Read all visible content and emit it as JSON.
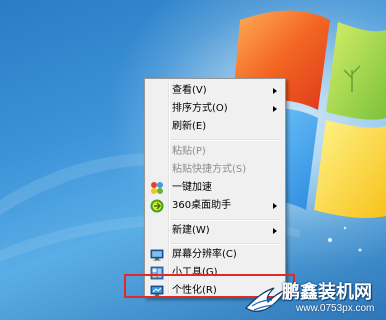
{
  "menu": {
    "items": [
      {
        "label": "查看(V)",
        "submenu": true,
        "disabled": false,
        "icon": null
      },
      {
        "label": "排序方式(O)",
        "submenu": true,
        "disabled": false,
        "icon": null
      },
      {
        "label": "刷新(E)",
        "submenu": false,
        "disabled": false,
        "icon": null
      },
      {
        "label": "粘贴(P)",
        "submenu": false,
        "disabled": true,
        "icon": null
      },
      {
        "label": "粘贴快捷方式(S)",
        "submenu": false,
        "disabled": true,
        "icon": null
      },
      {
        "label": "一键加速",
        "submenu": false,
        "disabled": false,
        "icon": "speedup-icon"
      },
      {
        "label": "360桌面助手",
        "submenu": true,
        "disabled": false,
        "icon": "360-assistant-icon"
      },
      {
        "label": "新建(W)",
        "submenu": true,
        "disabled": false,
        "icon": null
      },
      {
        "label": "屏幕分辨率(C)",
        "submenu": false,
        "disabled": false,
        "icon": "monitor-icon"
      },
      {
        "label": "小工具(G)",
        "submenu": false,
        "disabled": false,
        "icon": "gadgets-icon"
      },
      {
        "label": "个性化(R)",
        "submenu": false,
        "disabled": false,
        "icon": "personalize-icon"
      }
    ]
  },
  "highlight": {
    "target": "个性化(R)",
    "color": "#e02a2a"
  },
  "watermark": {
    "brand": "鹏鑫装机网",
    "url": "www.0753px.com"
  },
  "colors": {
    "menu_bg": "#f0f0f0",
    "disabled_text": "#8d8d8d",
    "desktop_blue": "#3c93d8"
  }
}
